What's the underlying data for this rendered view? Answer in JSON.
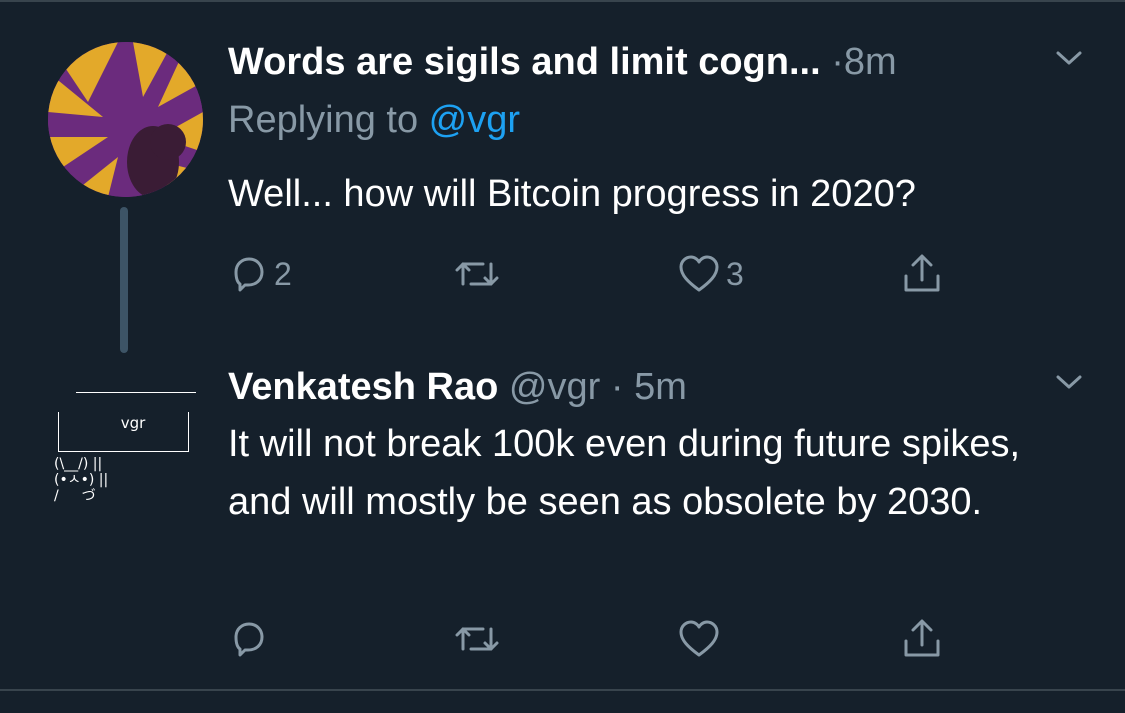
{
  "colors": {
    "background": "#15202b",
    "secondary_text": "#8899a6",
    "accent": "#1da1f2",
    "divider": "#38444d"
  },
  "tweets": [
    {
      "display_name": "Words are sigils and limit cogn...",
      "handle": "",
      "separator": "·",
      "time": "8m",
      "replying_prefix": "Replying to ",
      "replying_to": "@vgr",
      "text": "Well... how will Bitcoin progress in 2020?",
      "reply_count": "2",
      "retweet_count": "",
      "like_count": "3"
    },
    {
      "display_name": "Venkatesh Rao",
      "handle": "@vgr",
      "separator": "·",
      "time": "5m",
      "text": "It will not break 100k even during future spikes, and will mostly be seen as obsolete by 2030.",
      "reply_count": "",
      "retweet_count": "",
      "like_count": "",
      "avatar_text": "vgr",
      "avatar_bunny": "(\\__/) ||\n(•ㅅ•) ||\n/ 　 づ"
    }
  ],
  "icons": {
    "reply": "reply-icon",
    "retweet": "retweet-icon",
    "like": "heart-icon",
    "share": "share-icon",
    "more": "chevron-down-icon"
  }
}
